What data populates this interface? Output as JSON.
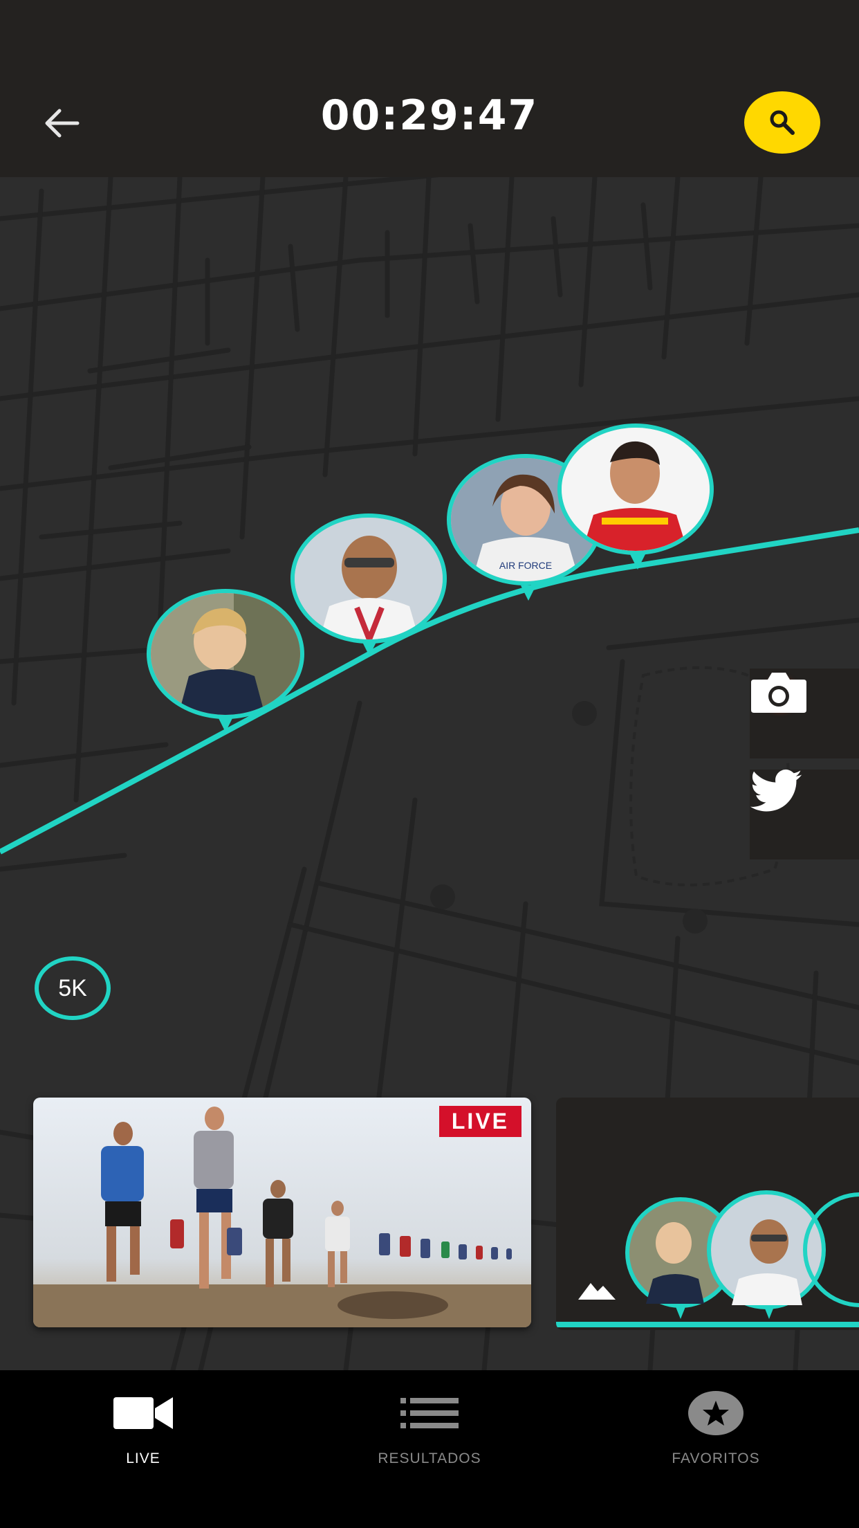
{
  "header": {
    "timer": "00:29:47",
    "back_icon": "arrow-left-icon",
    "search_icon": "search-icon",
    "search_color": "#ffd800"
  },
  "map": {
    "route_color": "#21d4c4",
    "km_marker": "5K",
    "runner_count_on_route": 4,
    "side_actions": [
      {
        "name": "camera",
        "icon": "camera-icon",
        "indicator": "recording-dot"
      },
      {
        "name": "twitter",
        "icon": "twitter-icon"
      }
    ]
  },
  "cards": {
    "video": {
      "badge": "LIVE",
      "badge_color": "#d4102a"
    },
    "map_preview": {
      "icon": "mountain-icon"
    }
  },
  "bottom_nav": {
    "items": [
      {
        "label": "LIVE",
        "icon": "video-camera-icon",
        "active": true
      },
      {
        "label": "RESULTADOS",
        "icon": "list-icon",
        "active": false
      },
      {
        "label": "FAVORITOS",
        "icon": "star-icon",
        "active": false
      }
    ]
  }
}
